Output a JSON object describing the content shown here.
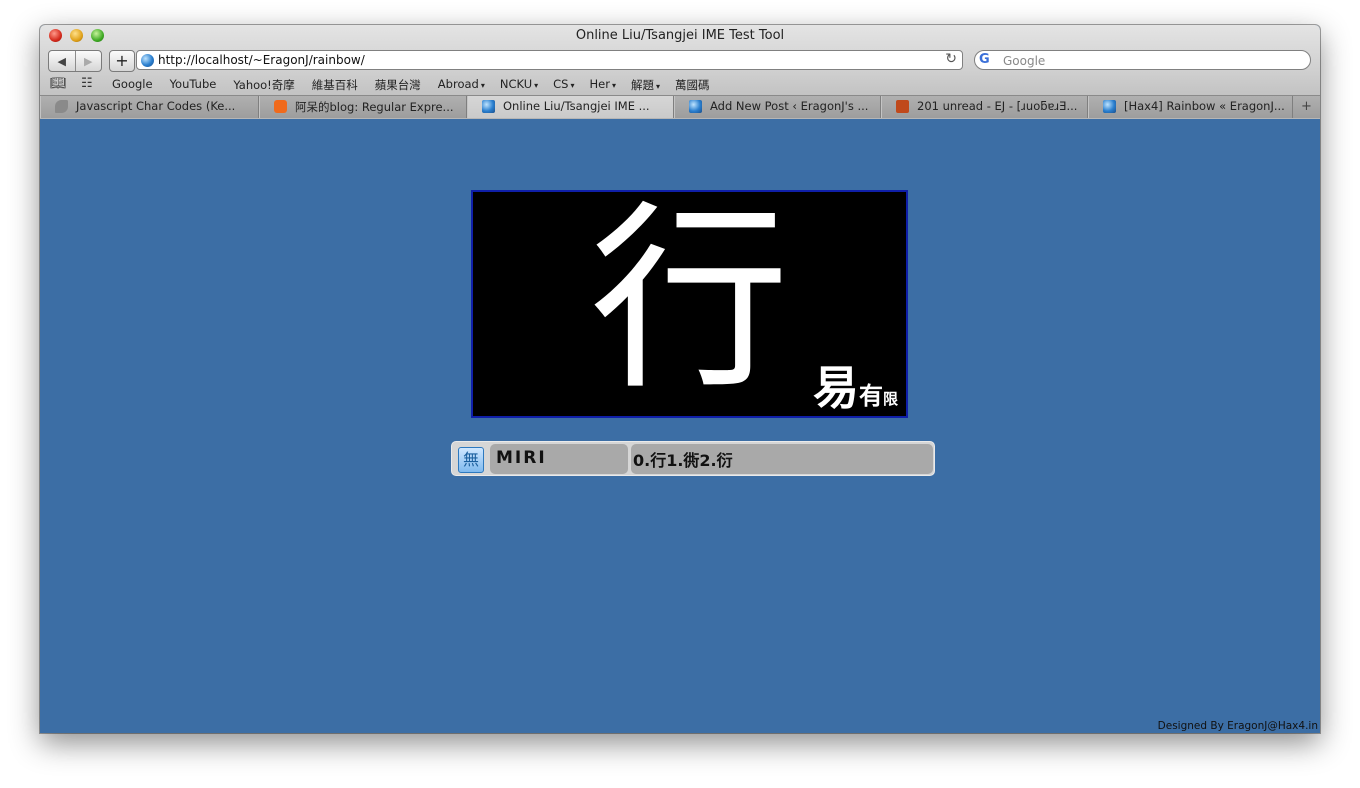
{
  "window": {
    "title": "Online Liu/Tsangjei IME Test Tool"
  },
  "toolbar": {
    "back": "◀",
    "forward": "▶",
    "add": "+",
    "url": "http://localhost/~EragonJ/rainbow/",
    "reload": "↻",
    "search_placeholder": "Google"
  },
  "bookmarks": {
    "book_icon": "open-book-icon",
    "grid_icon": "grid-icon",
    "items": [
      {
        "label": "Google",
        "menu": ""
      },
      {
        "label": "YouTube",
        "menu": ""
      },
      {
        "label": "Yahoo!奇摩",
        "menu": ""
      },
      {
        "label": "維基百科",
        "menu": ""
      },
      {
        "label": "蘋果台灣",
        "menu": ""
      },
      {
        "label": "Abroad",
        "menu": "▾"
      },
      {
        "label": "NCKU",
        "menu": "▾"
      },
      {
        "label": "CS",
        "menu": "▾"
      },
      {
        "label": "Her",
        "menu": "▾"
      },
      {
        "label": "解題",
        "menu": "▾"
      },
      {
        "label": "萬國碼",
        "menu": ""
      }
    ]
  },
  "tabs": [
    {
      "label": "Javascript Char Codes (Ke...",
      "icon": "bird-icon"
    },
    {
      "label": "阿呆的blog: Regular Expre...",
      "icon": "blogger-icon"
    },
    {
      "label": "Online Liu/Tsangjei IME ...",
      "icon": "globe-icon"
    },
    {
      "label": "Add New Post ‹ EragonJ's ...",
      "icon": "globe-icon"
    },
    {
      "label": "201 unread - EJ - [ɹuoƃɐɹƎ...",
      "icon": "plurk-icon"
    },
    {
      "label": "[Hax4] Rainbow « EragonJ...",
      "icon": "globe-icon"
    }
  ],
  "tab_add": "+",
  "ime": {
    "main_char": "行",
    "secondary_chars": [
      "易",
      "有",
      "限"
    ],
    "mode_icon_label": "無",
    "code": "MIRI",
    "candidates": "0.行1.衖2.衍"
  },
  "footer": "Designed By EragonJ@Hax4.in",
  "colors": {
    "content_bg": "#3c6ea5",
    "char_box_border": "#0f1fa8"
  }
}
